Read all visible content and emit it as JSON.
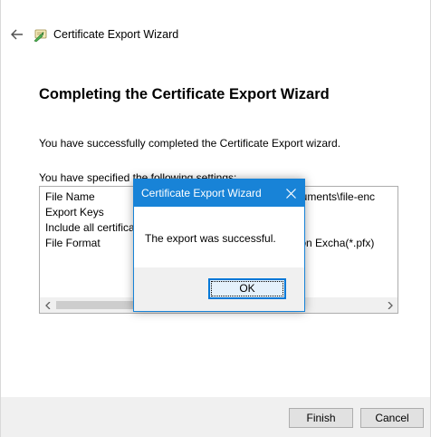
{
  "wizard": {
    "title": "Certificate Export Wizard",
    "heading": "Completing the Certificate Export Wizard",
    "description": "You have successfully completed the Certificate Export wizard.",
    "specified_label": "You have specified the following settings:",
    "settings": [
      {
        "name": "File Name",
        "value": "m\\Documents\\file-enc"
      },
      {
        "name": "Export Keys",
        "value": ""
      },
      {
        "name": "Include all certificate",
        "value": ""
      },
      {
        "name": "File Format",
        "value": "ormation Excha(*.pfx)"
      }
    ],
    "buttons": {
      "finish": "Finish",
      "cancel": "Cancel"
    },
    "icons": {
      "back": "back-arrow-icon",
      "app": "certificate-wizard-icon"
    }
  },
  "dialog": {
    "title": "Certificate Export Wizard",
    "message": "The export was successful.",
    "ok_label": "OK",
    "close_icon": "close-icon"
  },
  "colors": {
    "accent": "#1883d7",
    "footer": "#f0f0f0",
    "button": "#e1e1e1",
    "focused_button": "#e5f1fb"
  }
}
